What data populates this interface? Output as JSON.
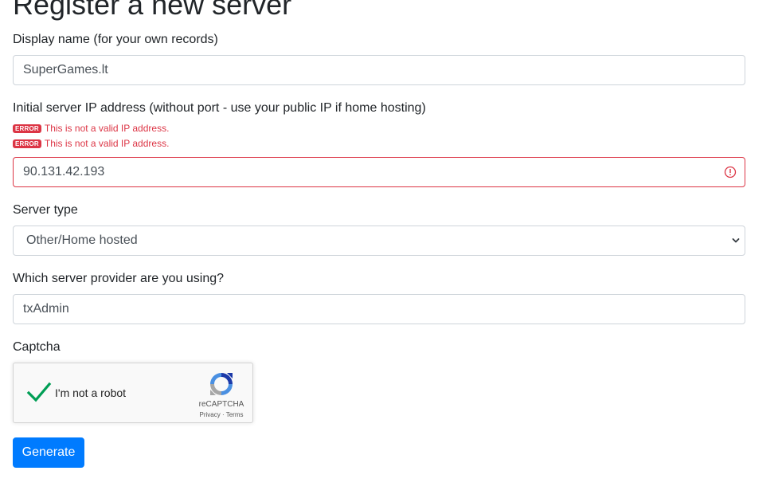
{
  "page": {
    "title": "Register a new server"
  },
  "form": {
    "display_name": {
      "label": "Display name (for your own records)",
      "value": "SuperGames.lt"
    },
    "ip_address": {
      "label": "Initial server IP address (without port - use your public IP if home hosting)",
      "value": "90.131.42.193",
      "errors": [
        {
          "badge": "ERROR",
          "message": "This is not a valid IP address."
        },
        {
          "badge": "ERROR",
          "message": "This is not a valid IP address."
        }
      ]
    },
    "server_type": {
      "label": "Server type",
      "selected": "Other/Home hosted"
    },
    "provider": {
      "label": "Which server provider are you using?",
      "value": "txAdmin"
    },
    "captcha": {
      "label": "Captcha",
      "checkbox_label": "I'm not a robot",
      "brand": "reCAPTCHA",
      "links": "Privacy - Terms",
      "checked": true
    },
    "submit_label": "Generate"
  },
  "colors": {
    "primary": "#007bff",
    "error": "#dc3545",
    "check": "#009e55"
  }
}
